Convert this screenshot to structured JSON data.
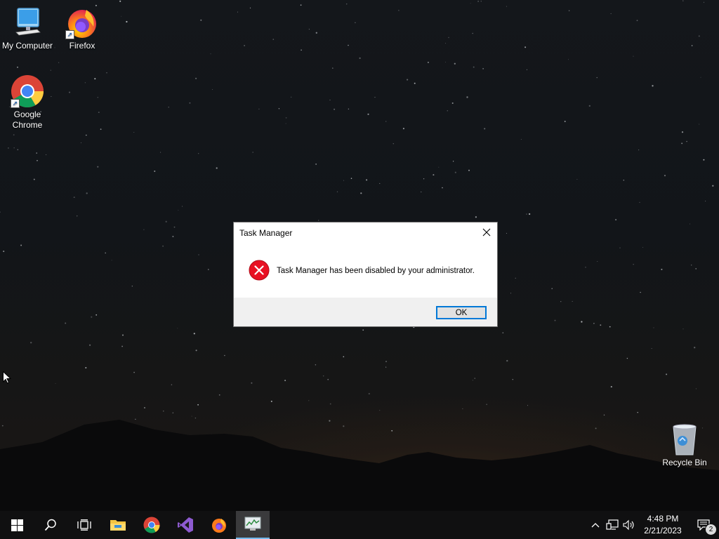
{
  "desktop": {
    "icons": [
      {
        "label": "My Computer",
        "icon": "computer-icon"
      },
      {
        "label": "Firefox",
        "icon": "firefox-icon"
      },
      {
        "label": "Google Chrome",
        "icon": "chrome-icon"
      },
      {
        "label": "Recycle Bin",
        "icon": "recycle-bin-icon"
      }
    ]
  },
  "dialog": {
    "title": "Task Manager",
    "message": "Task Manager has been disabled by your administrator.",
    "ok_label": "OK",
    "icon": "error-icon",
    "accent": "#0078d7",
    "error_color": "#e81123"
  },
  "taskbar": {
    "apps": [
      "start-icon",
      "search-icon",
      "task-view-icon",
      "file-explorer-icon",
      "chrome-icon",
      "visual-studio-icon",
      "firefox-icon",
      "task-manager-icon"
    ],
    "active_app": "task-manager-icon",
    "tray": {
      "time": "4:48 PM",
      "date": "2/21/2023",
      "notification_count": "2"
    }
  }
}
